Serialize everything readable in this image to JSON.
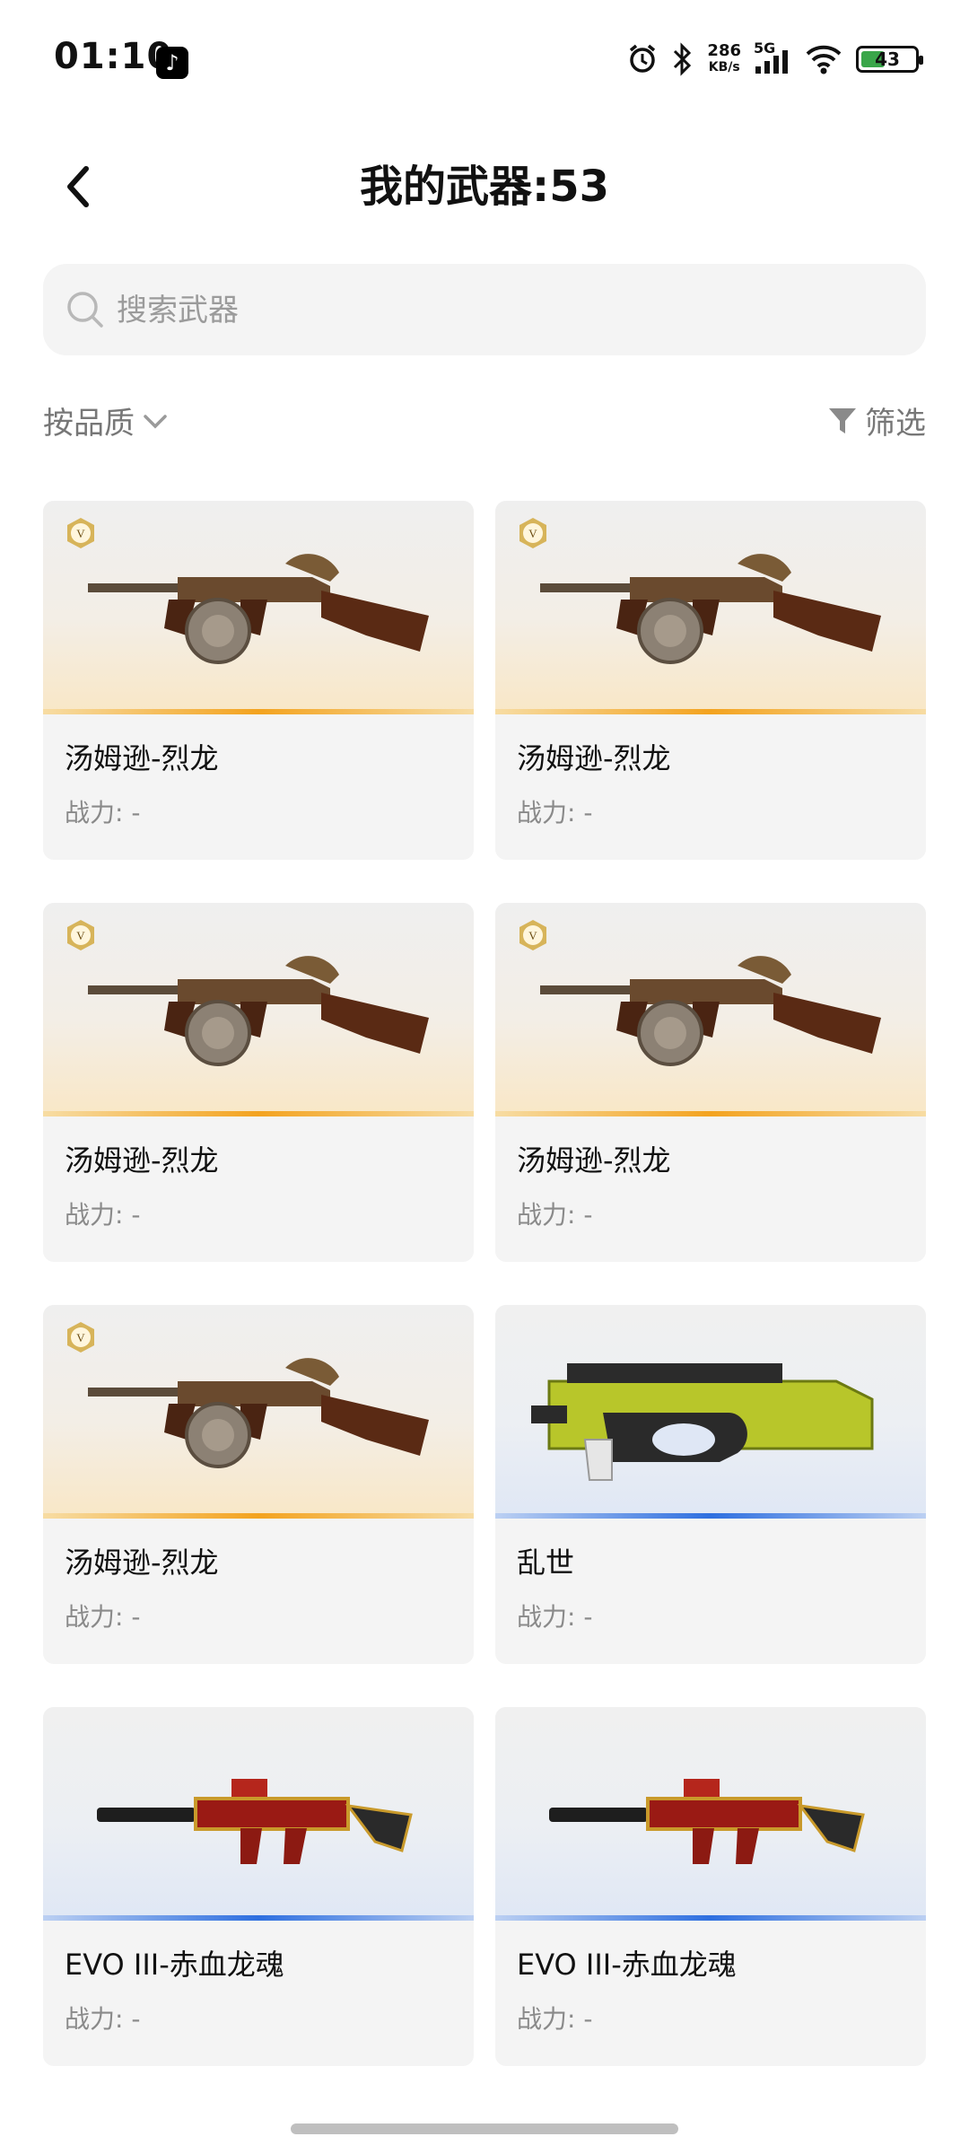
{
  "status_bar": {
    "time": "01:10",
    "net_speed": "286",
    "net_unit": "KB/s",
    "network": "5G",
    "battery": "43"
  },
  "header": {
    "title": "我的武器:53"
  },
  "search": {
    "placeholder": "搜索武器"
  },
  "toolbar": {
    "sort_label": "按品质",
    "filter_label": "筛选"
  },
  "weapons": [
    {
      "name": "汤姆逊-烈龙",
      "power": "战力: -",
      "quality": "gold"
    },
    {
      "name": "汤姆逊-烈龙",
      "power": "战力: -",
      "quality": "gold"
    },
    {
      "name": "汤姆逊-烈龙",
      "power": "战力: -",
      "quality": "gold"
    },
    {
      "name": "汤姆逊-烈龙",
      "power": "战力: -",
      "quality": "gold"
    },
    {
      "name": "汤姆逊-烈龙",
      "power": "战力: -",
      "quality": "gold"
    },
    {
      "name": "乱世",
      "power": "战力: -",
      "quality": "blue"
    },
    {
      "name": "EVO III-赤血龙魂",
      "power": "战力: -",
      "quality": "blue"
    },
    {
      "name": "EVO III-赤血龙魂",
      "power": "战力: -",
      "quality": "blue"
    }
  ],
  "colors": {
    "gold_accent": "#f3a31f",
    "blue_accent": "#2e6fe0",
    "card_bg": "#f4f4f4"
  }
}
